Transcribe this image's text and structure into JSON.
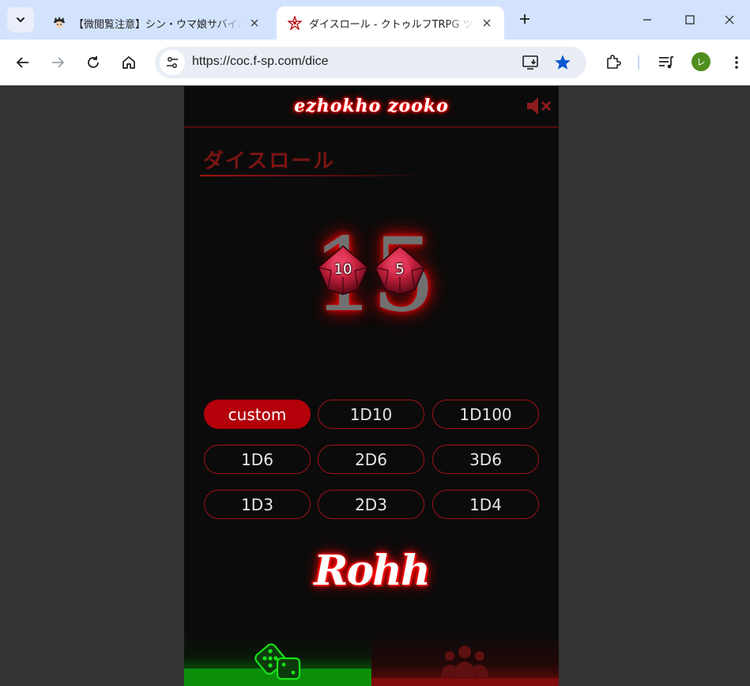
{
  "browser": {
    "tabs": [
      {
        "title": "【微閲覧注意】シン・ウマ娘サバイバ",
        "active": false,
        "favicon": "anime-character-icon"
      },
      {
        "title": "ダイスロール - クトゥルフTRPG ツー",
        "active": true,
        "favicon": "star-pentagram-icon"
      }
    ],
    "url": "https://coc.f-sp.com/dice",
    "profile_initial": "レ"
  },
  "app": {
    "logo": "ezhokho zooko",
    "page_title": "ダイスロール",
    "result": "15",
    "dice": [
      {
        "face": "10",
        "icon": "d10-die-icon"
      },
      {
        "face": "5",
        "icon": "d10-die-icon"
      }
    ],
    "presets": [
      {
        "label": "custom",
        "selected": true
      },
      {
        "label": "1D10",
        "selected": false
      },
      {
        "label": "1D100",
        "selected": false
      },
      {
        "label": "1D6",
        "selected": false
      },
      {
        "label": "2D6",
        "selected": false
      },
      {
        "label": "3D6",
        "selected": false
      },
      {
        "label": "1D3",
        "selected": false
      },
      {
        "label": "2D3",
        "selected": false
      },
      {
        "label": "1D4",
        "selected": false
      }
    ],
    "roll_label": "Rohh",
    "colors": {
      "accent_red": "#b3000a",
      "glow_red": "#ff0000",
      "nav_active_green": "#0b8f0b",
      "nav_inactive_red": "#800c0c"
    }
  }
}
